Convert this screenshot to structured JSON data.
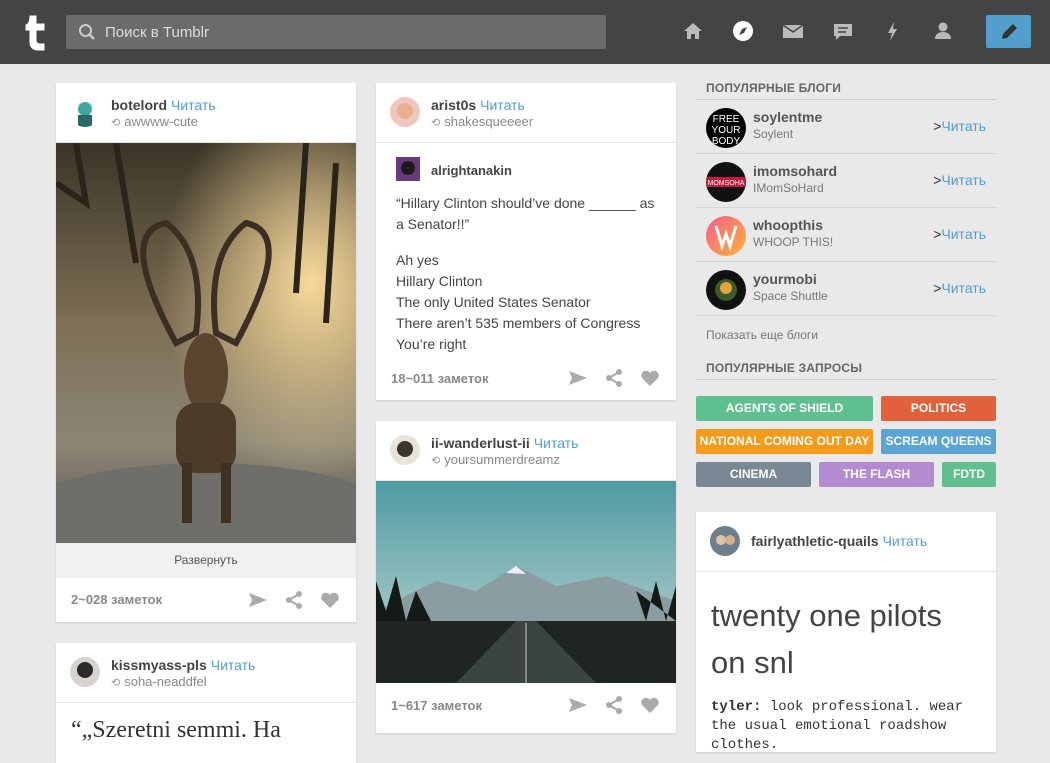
{
  "app": {
    "search_placeholder": "Поиск в Tumblr"
  },
  "nav": {
    "icons": [
      "home-icon",
      "compass-icon",
      "mail-icon",
      "chat-icon",
      "lightning-icon",
      "person-icon"
    ],
    "compose_icon": "pencil-icon",
    "compose_color": "#529ecc"
  },
  "posts": [
    {
      "user": "botelord",
      "follow": "Читать",
      "reblog": "awwww-cute",
      "expand": "Развернуть",
      "notes": "2~028 заметок"
    },
    {
      "user": "kissmyass-pls",
      "follow": "Читать",
      "reblog": "soha-neaddfel",
      "quote": "“„Szeretni semmi. Ha"
    },
    {
      "user": "arist0s",
      "follow": "Читать",
      "reblog": "shakesqueeeer",
      "inner_user": "alrightanakin",
      "lines": [
        "“Hillary Clinton should’ve done ______ as a Senator!!”",
        "Ah yes",
        "Hillary Clinton",
        "The only United States Senator",
        "There aren’t 535 members of Congress",
        "You’re right"
      ],
      "notes": "18~011 заметок"
    },
    {
      "user": "ii-wanderlust-ii",
      "follow": "Читать",
      "reblog": "yoursummerdreamz",
      "notes": "1~617 заметок"
    },
    {
      "user": "fairlyathletic-quails",
      "follow": "Читать",
      "headline": "twenty one pilots on snl",
      "mono_speaker": "tyler:",
      "mono_text": " look professional. wear the usual emotional roadshow clothes."
    }
  ],
  "sidebar": {
    "popular_blogs_title": "ПОПУЛЯРНЫЕ БЛОГИ",
    "blogs": [
      {
        "name": "soylentme",
        "sub": "Soylent",
        "follow": "Читать",
        "arrow": ">"
      },
      {
        "name": "imomsohard",
        "sub": "IMomSoHard",
        "follow": "Читать",
        "arrow": ">"
      },
      {
        "name": "whoopthis",
        "sub": "WHOOP THIS!",
        "follow": "Читать",
        "arrow": ">"
      },
      {
        "name": "yourmobi",
        "sub": "Space Shuttle",
        "follow": "Читать",
        "arrow": ">"
      }
    ],
    "more_blogs": "Показать еще блоги",
    "popular_searches_title": "ПОПУЛЯРНЫЕ ЗАПРОСЫ",
    "tags": [
      {
        "label": "AGENTS OF SHIELD",
        "color": "#5fbf8e"
      },
      {
        "label": "POLITICS",
        "color": "#e0613a"
      },
      {
        "label": "NATIONAL COMING OUT DAY",
        "color": "#f59a1b"
      },
      {
        "label": "SCREAM QUEENS",
        "color": "#5aa5d6"
      },
      {
        "label": "CINEMA",
        "color": "#7a8795"
      },
      {
        "label": "THE FLASH",
        "color": "#b38bd0"
      },
      {
        "label": "FDTD",
        "color": "#5fbf8e"
      }
    ]
  }
}
